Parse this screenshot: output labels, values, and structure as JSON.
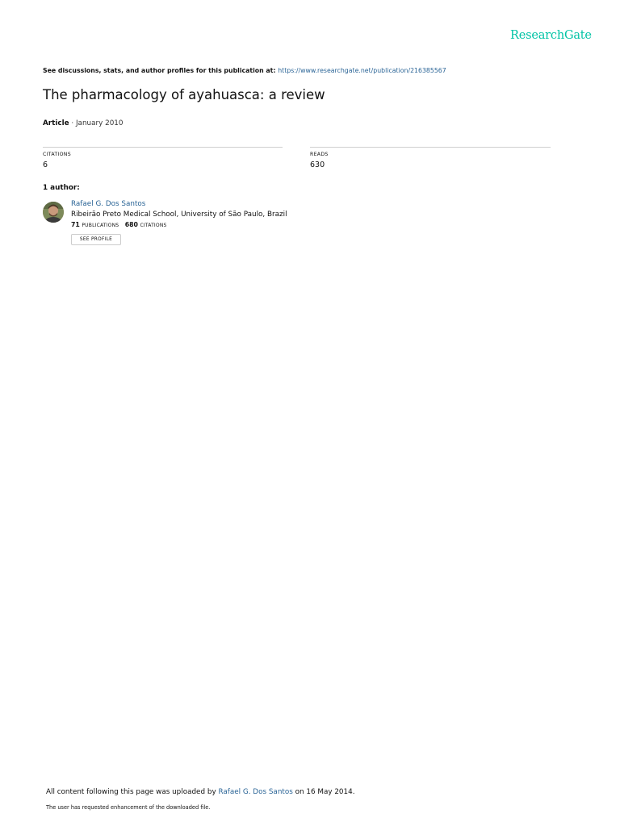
{
  "brand": "ResearchGate",
  "header": {
    "discuss_text": "See discussions, stats, and author profiles for this publication at: ",
    "discuss_url": "https://www.researchgate.net/publication/216385567"
  },
  "publication": {
    "title": "The pharmacology of ayahuasca: a review",
    "type": "Article",
    "date_text": " · January 2010"
  },
  "stats": {
    "citations_label": "CITATIONS",
    "citations_value": "6",
    "reads_label": "READS",
    "reads_value": "630"
  },
  "authors": {
    "heading": "1 author:",
    "items": [
      {
        "name": "Rafael G. Dos Santos",
        "institution": "Ribeirão Preto Medical School, University of São Paulo, Brazil",
        "publications_count": "71",
        "publications_label": "PUBLICATIONS",
        "citations_count": "680",
        "citations_label": "CITATIONS",
        "button_label": "SEE PROFILE"
      }
    ]
  },
  "footer": {
    "upload_prefix": "All content following this page was uploaded by ",
    "uploader": "Rafael G. Dos Santos",
    "upload_suffix": " on 16 May 2014.",
    "note": "The user has requested enhancement of the downloaded file."
  }
}
